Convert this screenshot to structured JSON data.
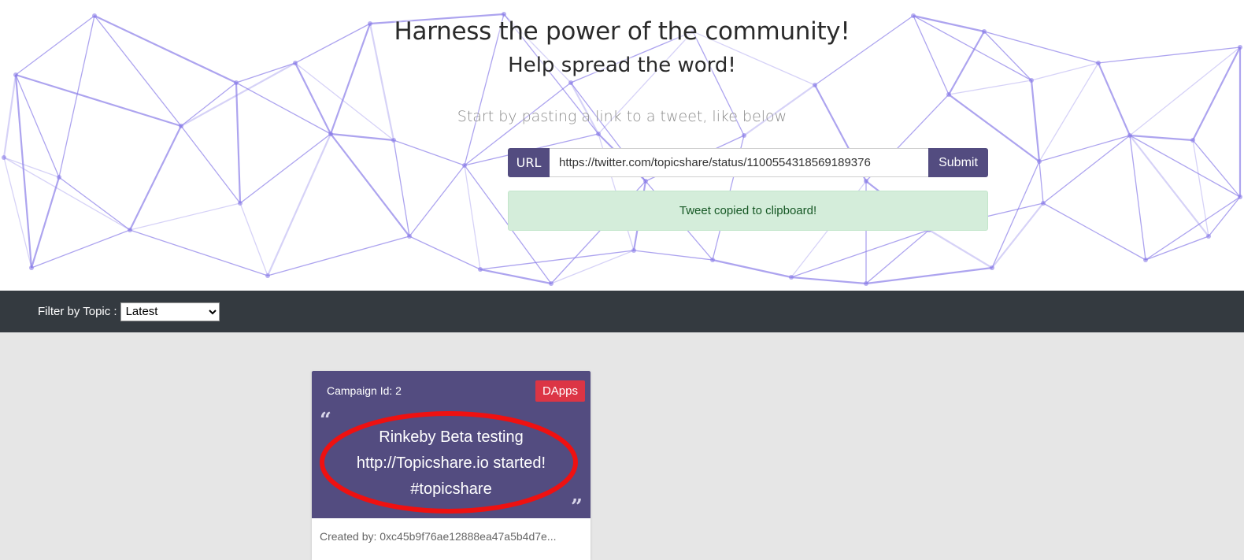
{
  "hero": {
    "title": "Harness the power of the community!",
    "subtitle": "Help spread the word!",
    "hint": "Start by pasting a link to a tweet, like below",
    "url_label": "URL",
    "url_value": "https://twitter.com/topicshare/status/1100554318569189376",
    "submit_label": "Submit",
    "alert": "Tweet copied to clipboard!"
  },
  "filter": {
    "label": "Filter by Topic :",
    "selected": "Latest"
  },
  "cards": [
    {
      "campaign_id": "Campaign Id: 2",
      "badge": "DApps",
      "text": "Rinkeby Beta testing\nhttp://Topicshare.io  started!\n#topicshare",
      "created_by": "Created by: 0xc45b9f76ae12888ea47a5b4d7e..."
    }
  ],
  "colors": {
    "brand_purple": "#534c80",
    "badge_red": "#dc3545",
    "dark_bar": "#343a40",
    "alert_green": "#d4edda",
    "mesh_line": "#8a7de8",
    "annotation_red": "#ee1111"
  }
}
